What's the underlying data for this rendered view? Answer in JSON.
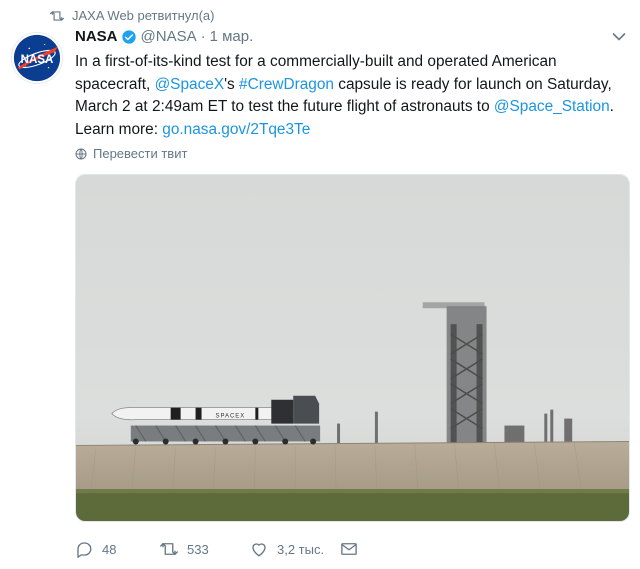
{
  "retweet_context": {
    "text": "JAXA Web ретвитнул(а)",
    "icon": "retweet-icon"
  },
  "author": {
    "name": "NASA",
    "handle": "@NASA",
    "separator": "·",
    "time": "1 мар.",
    "avatar_icon": "nasa-logo",
    "avatar_text": "NASA",
    "verified_icon": "verified-badge-icon"
  },
  "tweet": {
    "p1": "In a first-of-its-kind test for a commercially-built and operated American spacecraft, ",
    "mention1": "@SpaceX",
    "p2": "'s ",
    "hashtag": "#CrewDragon",
    "p3": " capsule is ready for launch on Saturday, March 2 at 2:49am ET to test the future flight of astronauts to ",
    "mention2": "@Space_Station",
    "p4": ". Learn more: ",
    "url": "go.nasa.gov/2Tqe3Te"
  },
  "translate": {
    "label": "Перевести твит",
    "icon": "globe-icon"
  },
  "media": {
    "description_icon": "rocket-launchpad-photo"
  },
  "actions": {
    "replies": "48",
    "retweets": "533",
    "likes": "3,2 тыс."
  },
  "colors": {
    "link": "#1b95e0",
    "muted": "#657786",
    "verified": "#1da1f2",
    "nasa_blue": "#0b3d91",
    "nasa_red": "#fc3d21"
  }
}
